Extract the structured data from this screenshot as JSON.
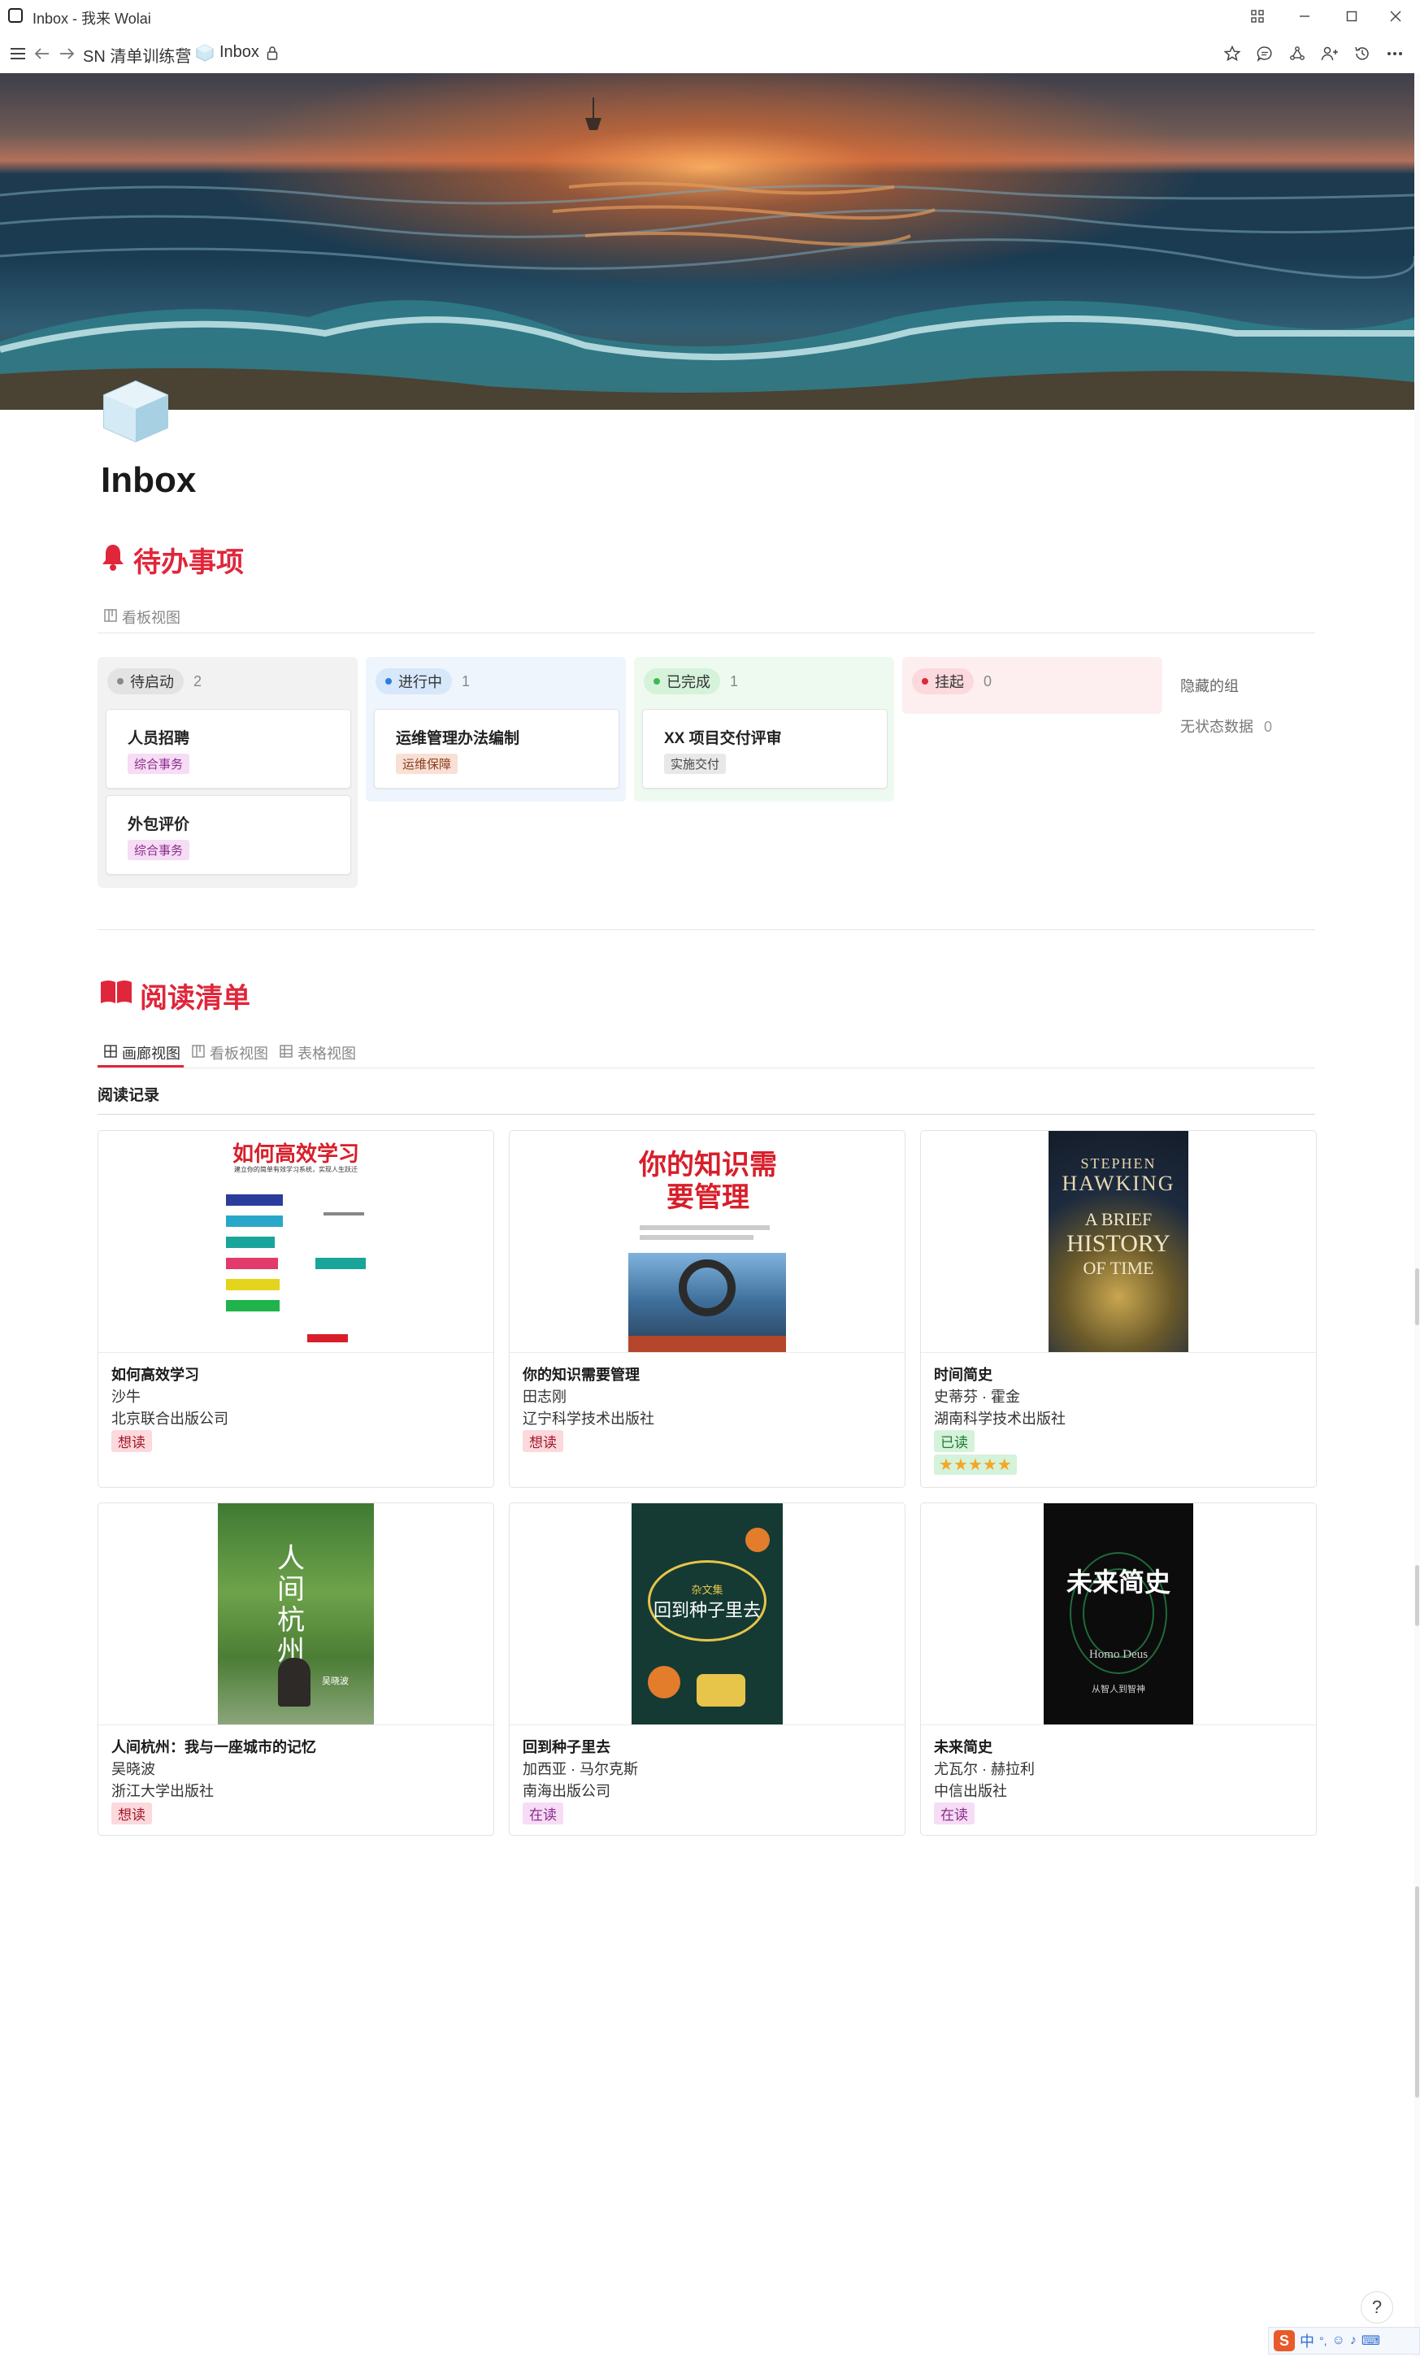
{
  "window": {
    "title": "Inbox - 我来 Wolai"
  },
  "nav": {
    "workspace": "SN 清单训练营",
    "page": "Inbox",
    "separator": ">"
  },
  "page": {
    "title": "Inbox"
  },
  "todo": {
    "title": "待办事项",
    "view_tab": "看板视图",
    "columns": [
      {
        "label": "待启动",
        "count": "2",
        "color": "#8a8a8a"
      },
      {
        "label": "进行中",
        "count": "1",
        "color": "#2f7de1"
      },
      {
        "label": "已完成",
        "count": "1",
        "color": "#3fb950"
      },
      {
        "label": "挂起",
        "count": "0",
        "color": "#e0263a"
      }
    ],
    "cards": [
      {
        "title": "人员招聘",
        "tag": "综合事务"
      },
      {
        "title": "外包评价",
        "tag": "综合事务"
      },
      {
        "title": "运维管理办法编制",
        "tag": "运维保障"
      },
      {
        "title": "XX 项目交付评审",
        "tag": "实施交付"
      }
    ],
    "hidden_groups": "隐藏的组",
    "no_status": {
      "label": "无状态数据",
      "count": "0"
    }
  },
  "reading": {
    "title": "阅读清单",
    "tabs": [
      "画廊视图",
      "看板视图",
      "表格视图"
    ],
    "group_title": "阅读记录",
    "books": [
      {
        "title": "如何高效学习",
        "author": "沙牛",
        "publisher": "北京联合出版公司",
        "status": "想读",
        "cover_title": "如何高效学习",
        "cover_sub": "建立你的简单有效学习系统，实现人生跃迁"
      },
      {
        "title": "你的知识需要管理",
        "author": "田志刚",
        "publisher": "辽宁科学技术出版社",
        "status": "想读",
        "cover_title": "你的知识需要管理"
      },
      {
        "title": "时间简史",
        "author": "史蒂芬 · 霍金",
        "publisher": "湖南科学技术出版社",
        "status": "已读",
        "rating": 5,
        "cover_l1": "STEPHEN",
        "cover_l2": "HAWKING",
        "cover_l3": "A BRIEF",
        "cover_l4": "HISTORY",
        "cover_l5": "OF TIME"
      },
      {
        "title": "人间杭州：我与一座城市的记忆",
        "author": "吴晓波",
        "publisher": "浙江大学出版社",
        "status": "想读",
        "cover_title": "人间杭州",
        "cover_author": "吴晓波"
      },
      {
        "title": "回到种子里去",
        "author": "加西亚 · 马尔克斯",
        "publisher": "南海出版公司",
        "status": "在读",
        "cover_title": "回到种子里去",
        "cover_sub": "杂文集"
      },
      {
        "title": "未来简史",
        "author": "尤瓦尔 · 赫拉利",
        "publisher": "中信出版社",
        "status": "在读",
        "cover_title": "未来简史",
        "cover_sub": "Homo Deus",
        "cover_sub2": "从智人到智神"
      }
    ]
  },
  "colors": {
    "accent_red": "#e0263a",
    "tag_purple_bg": "#f6dcf5",
    "tag_purple_fg": "#8a2d8a"
  },
  "ime": {
    "lang": "中",
    "help": "?"
  }
}
